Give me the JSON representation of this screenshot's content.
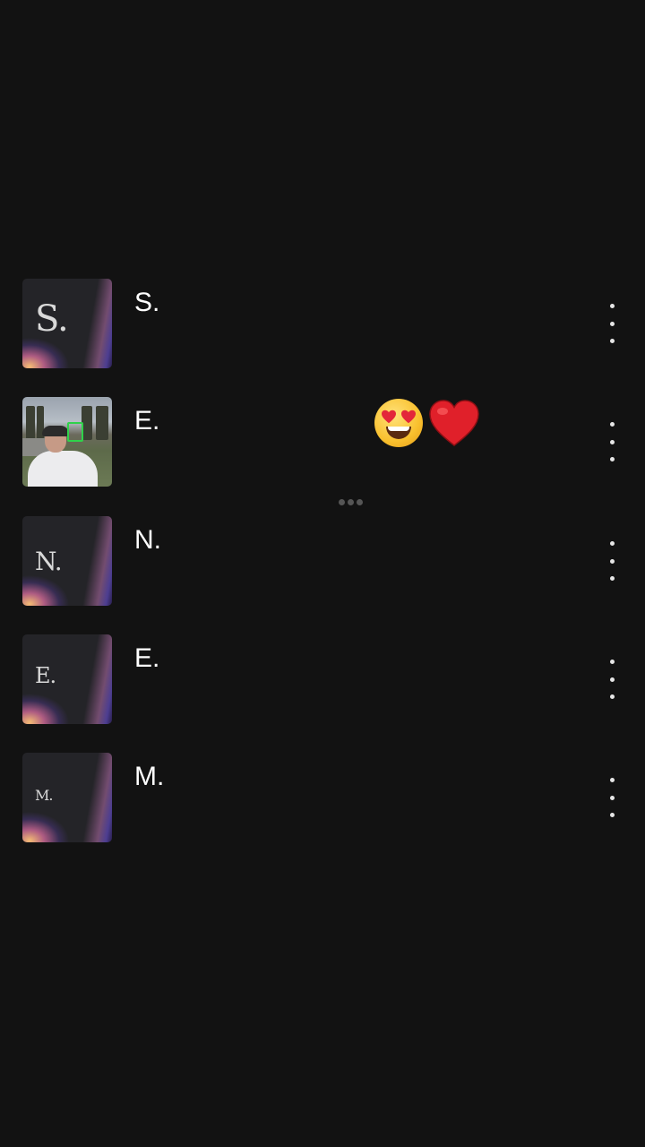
{
  "contacts": [
    {
      "name": "S.",
      "thumb_text": "S.",
      "thumb_type": "text-card"
    },
    {
      "name": "E.",
      "thumb_text": "",
      "thumb_type": "photo",
      "reaction": [
        "heart-eyes-emoji",
        "red-heart-emoji"
      ]
    },
    {
      "name": "N.",
      "thumb_text": "N.",
      "thumb_type": "text-card"
    },
    {
      "name": "E.",
      "thumb_text": "E.",
      "thumb_type": "text-card"
    },
    {
      "name": "M.",
      "thumb_text": "M.",
      "thumb_type": "text-card"
    }
  ],
  "icons": {
    "menu": "more-vertical-icon",
    "typing": "typing-dots-icon"
  },
  "colors": {
    "background": "#121212",
    "text": "#ffffff",
    "heart": "#e0202a",
    "face": "#f9c02e"
  }
}
